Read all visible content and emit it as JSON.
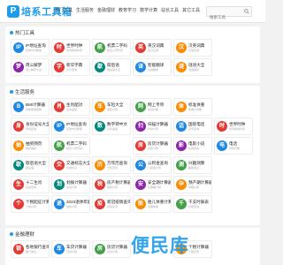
{
  "header": {
    "logo_mark": "P",
    "logo_text": "培系工具箱",
    "nav": [
      "热门工具",
      "生活服务",
      "金融理财",
      "教育学习",
      "数学计算",
      "站长工具",
      "其它工具"
    ],
    "search_placeholder": "搜索工具"
  },
  "sections": [
    {
      "title": "热门工具",
      "tiles": [
        {
          "name": "IP地址查询",
          "desc": "查询IP归属地",
          "color": "#1e88e5",
          "glyph": "IP"
        },
        {
          "name": "世界时钟",
          "desc": "世界各地时间",
          "color": "#e53935",
          "glyph": "时"
        },
        {
          "name": "机票二字码",
          "desc": "航空公司代码",
          "color": "#43a047",
          "glyph": "航"
        },
        {
          "name": "英汉词典",
          "desc": "英汉互译",
          "color": "#e53935",
          "glyph": "英"
        },
        {
          "name": "汉英词典",
          "desc": "汉英互译",
          "color": "#fb8c00",
          "glyph": "汉"
        },
        {
          "name": "",
          "desc": "",
          "color": "",
          "glyph": ""
        },
        {
          "name": "周公解梦",
          "desc": "周公解梦大全",
          "color": "#8e24aa",
          "glyph": "梦"
        },
        {
          "name": "新华字典",
          "desc": "汉字查询",
          "color": "#e53935",
          "glyph": "字"
        },
        {
          "name": "歇后语",
          "desc": "歇后语大全",
          "color": "#00897b",
          "glyph": "歇"
        },
        {
          "name": "智能翻译",
          "desc": "在线翻译",
          "color": "#1e88e5",
          "glyph": "译"
        },
        {
          "name": "谜语大全",
          "desc": "谜语猜猜",
          "color": "#fb8c00",
          "glyph": "谜"
        },
        {
          "name": "",
          "desc": "",
          "color": "",
          "glyph": ""
        }
      ]
    },
    {
      "title": "生活服务",
      "tiles": [
        {
          "name": "BMI计算器",
          "desc": "身体质量指数",
          "color": "#1e88e5",
          "glyph": "B"
        },
        {
          "name": "生肖配对",
          "desc": "生肖速配",
          "color": "#e53935",
          "glyph": "肖"
        },
        {
          "name": "车险大全",
          "desc": "保险计算",
          "color": "#fb8c00",
          "glyph": "车"
        },
        {
          "name": "网上专项",
          "desc": "在线办理",
          "color": "#43a047",
          "glyph": "网"
        },
        {
          "name": "标准体重",
          "desc": "体重计算器",
          "color": "#fb8c00",
          "glyph": "体"
        },
        {
          "name": "",
          "desc": "",
          "color": "",
          "glyph": ""
        },
        {
          "name": "身份证号大全",
          "desc": "号码查询",
          "color": "#e53935",
          "glyph": "身"
        },
        {
          "name": "IP地址查询",
          "desc": "查询IP归属地",
          "color": "#1e88e5",
          "glyph": "IP"
        },
        {
          "name": "数字转中文",
          "desc": "大写金额",
          "color": "#00897b",
          "glyph": "数"
        },
        {
          "name": "扫描计算器",
          "desc": "科学计算",
          "color": "#8e24aa",
          "glyph": "扫"
        },
        {
          "name": "国际电话",
          "desc": "区号查询",
          "color": "#1e88e5",
          "glyph": "话"
        },
        {
          "name": "世界时钟",
          "desc": "世界各地时间",
          "color": "#e53935",
          "glyph": "时"
        },
        {
          "name": "抽奖网页",
          "desc": "随机抽取",
          "color": "#fb8c00",
          "glyph": "抽"
        },
        {
          "name": "机票二字码",
          "desc": "航空公司代码",
          "color": "#43a047",
          "glyph": "航"
        },
        {
          "name": "",
          "desc": "",
          "color": "",
          "glyph": ""
        },
        {
          "name": "房贷计算器",
          "desc": "贷款计算",
          "color": "#e53935",
          "glyph": "房"
        },
        {
          "name": "电影小说",
          "desc": "在线查询",
          "color": "#8e24aa",
          "glyph": "影"
        },
        {
          "name": "电话",
          "desc": "号码归属",
          "color": "#1e88e5",
          "glyph": "电"
        },
        {
          "name": "歇后语大全",
          "desc": "歇后语",
          "color": "#00897b",
          "glyph": "歇"
        },
        {
          "name": "交通标志大全",
          "desc": "交通标识",
          "color": "#e53935",
          "glyph": "交"
        },
        {
          "name": "万年历查询",
          "desc": "日历农历",
          "color": "#fb8c00",
          "glyph": "历"
        },
        {
          "name": "公积金查询",
          "desc": "公积金计算",
          "color": "#1e88e5",
          "glyph": "公"
        },
        {
          "name": "兴趣测算",
          "desc": "趣味测试",
          "color": "#43a047",
          "glyph": "测"
        },
        {
          "name": "",
          "desc": "",
          "color": "",
          "glyph": ""
        },
        {
          "name": "十二生肖",
          "desc": "生肖查询",
          "color": "#e53935",
          "glyph": "生"
        },
        {
          "name": "划拨计算器",
          "desc": "在线计算",
          "color": "#00897b",
          "glyph": "划"
        },
        {
          "name": "房产税计算器",
          "desc": "税费计算",
          "color": "#e53935",
          "glyph": "税"
        },
        {
          "name": "安全期计算器",
          "desc": "生理期计算",
          "color": "#8e24aa",
          "glyph": "安"
        },
        {
          "name": "预产期计算器",
          "desc": "孕期计算",
          "color": "#fb8c00",
          "glyph": "孕"
        },
        {
          "name": "",
          "desc": "",
          "color": "",
          "glyph": ""
        },
        {
          "name": "个税起征计算器",
          "desc": "个税计算",
          "color": "#e53935",
          "glyph": "个"
        },
        {
          "name": "2023退休年龄",
          "desc": "退休计算",
          "color": "#1e88e5",
          "glyph": "退"
        },
        {
          "name": "新冠疫情查询",
          "desc": "疫情实况",
          "color": "#e53935",
          "glyph": "疫"
        },
        {
          "name": "胎儿体重计算",
          "desc": "孕期体重",
          "color": "#fb8c00",
          "glyph": "胎"
        },
        {
          "name": "千支时辰表",
          "desc": "时辰查询",
          "color": "#43a047",
          "glyph": "千"
        },
        {
          "name": "",
          "desc": "",
          "color": "",
          "glyph": ""
        }
      ]
    },
    {
      "title": "金融理财",
      "tiles": [
        {
          "name": "各地银行查询",
          "desc": "银行信息",
          "color": "#e53935",
          "glyph": "银"
        },
        {
          "name": "车贷计算器",
          "desc": "贷款计算",
          "color": "#1e88e5",
          "glyph": "车"
        },
        {
          "name": "房贷计算器",
          "desc": "贷款计算",
          "color": "#43a047",
          "glyph": "房"
        },
        {
          "name": "",
          "desc": "",
          "color": "",
          "glyph": ""
        },
        {
          "name": "个税计算器",
          "desc": "个税计算",
          "color": "#fb8c00",
          "glyph": "个"
        },
        {
          "name": "",
          "desc": "",
          "color": "",
          "glyph": ""
        }
      ]
    }
  ],
  "watermark": "便民库"
}
